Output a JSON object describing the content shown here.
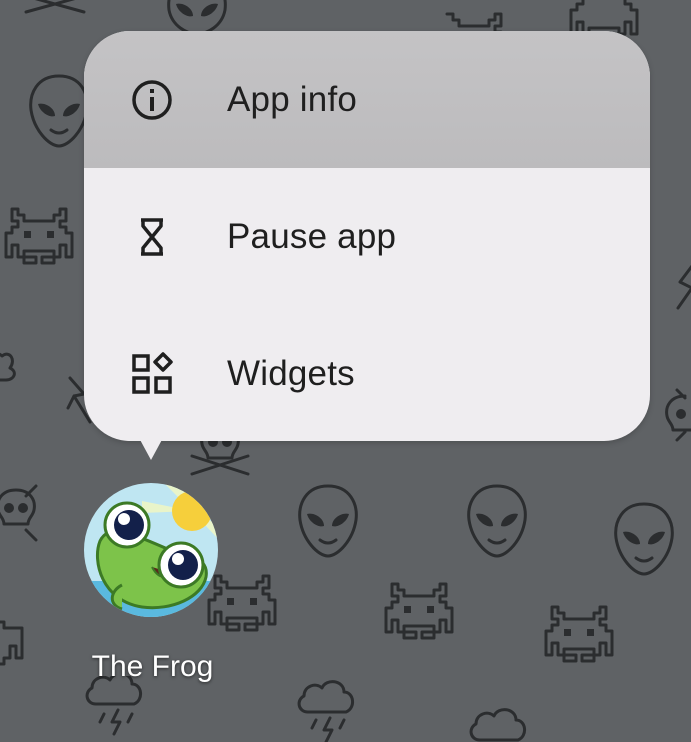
{
  "menu": {
    "items": [
      {
        "label": "App info",
        "icon": "info-icon"
      },
      {
        "label": "Pause app",
        "icon": "hourglass-icon"
      },
      {
        "label": "Widgets",
        "icon": "widgets-icon"
      }
    ]
  },
  "app": {
    "name": "The Frog",
    "icon": "frog-app-icon"
  },
  "colors": {
    "wallpaper": "#5f6265",
    "menu_background": "#efedf0",
    "highlight": "#c0bfc1",
    "text": "#1f1f1f"
  }
}
